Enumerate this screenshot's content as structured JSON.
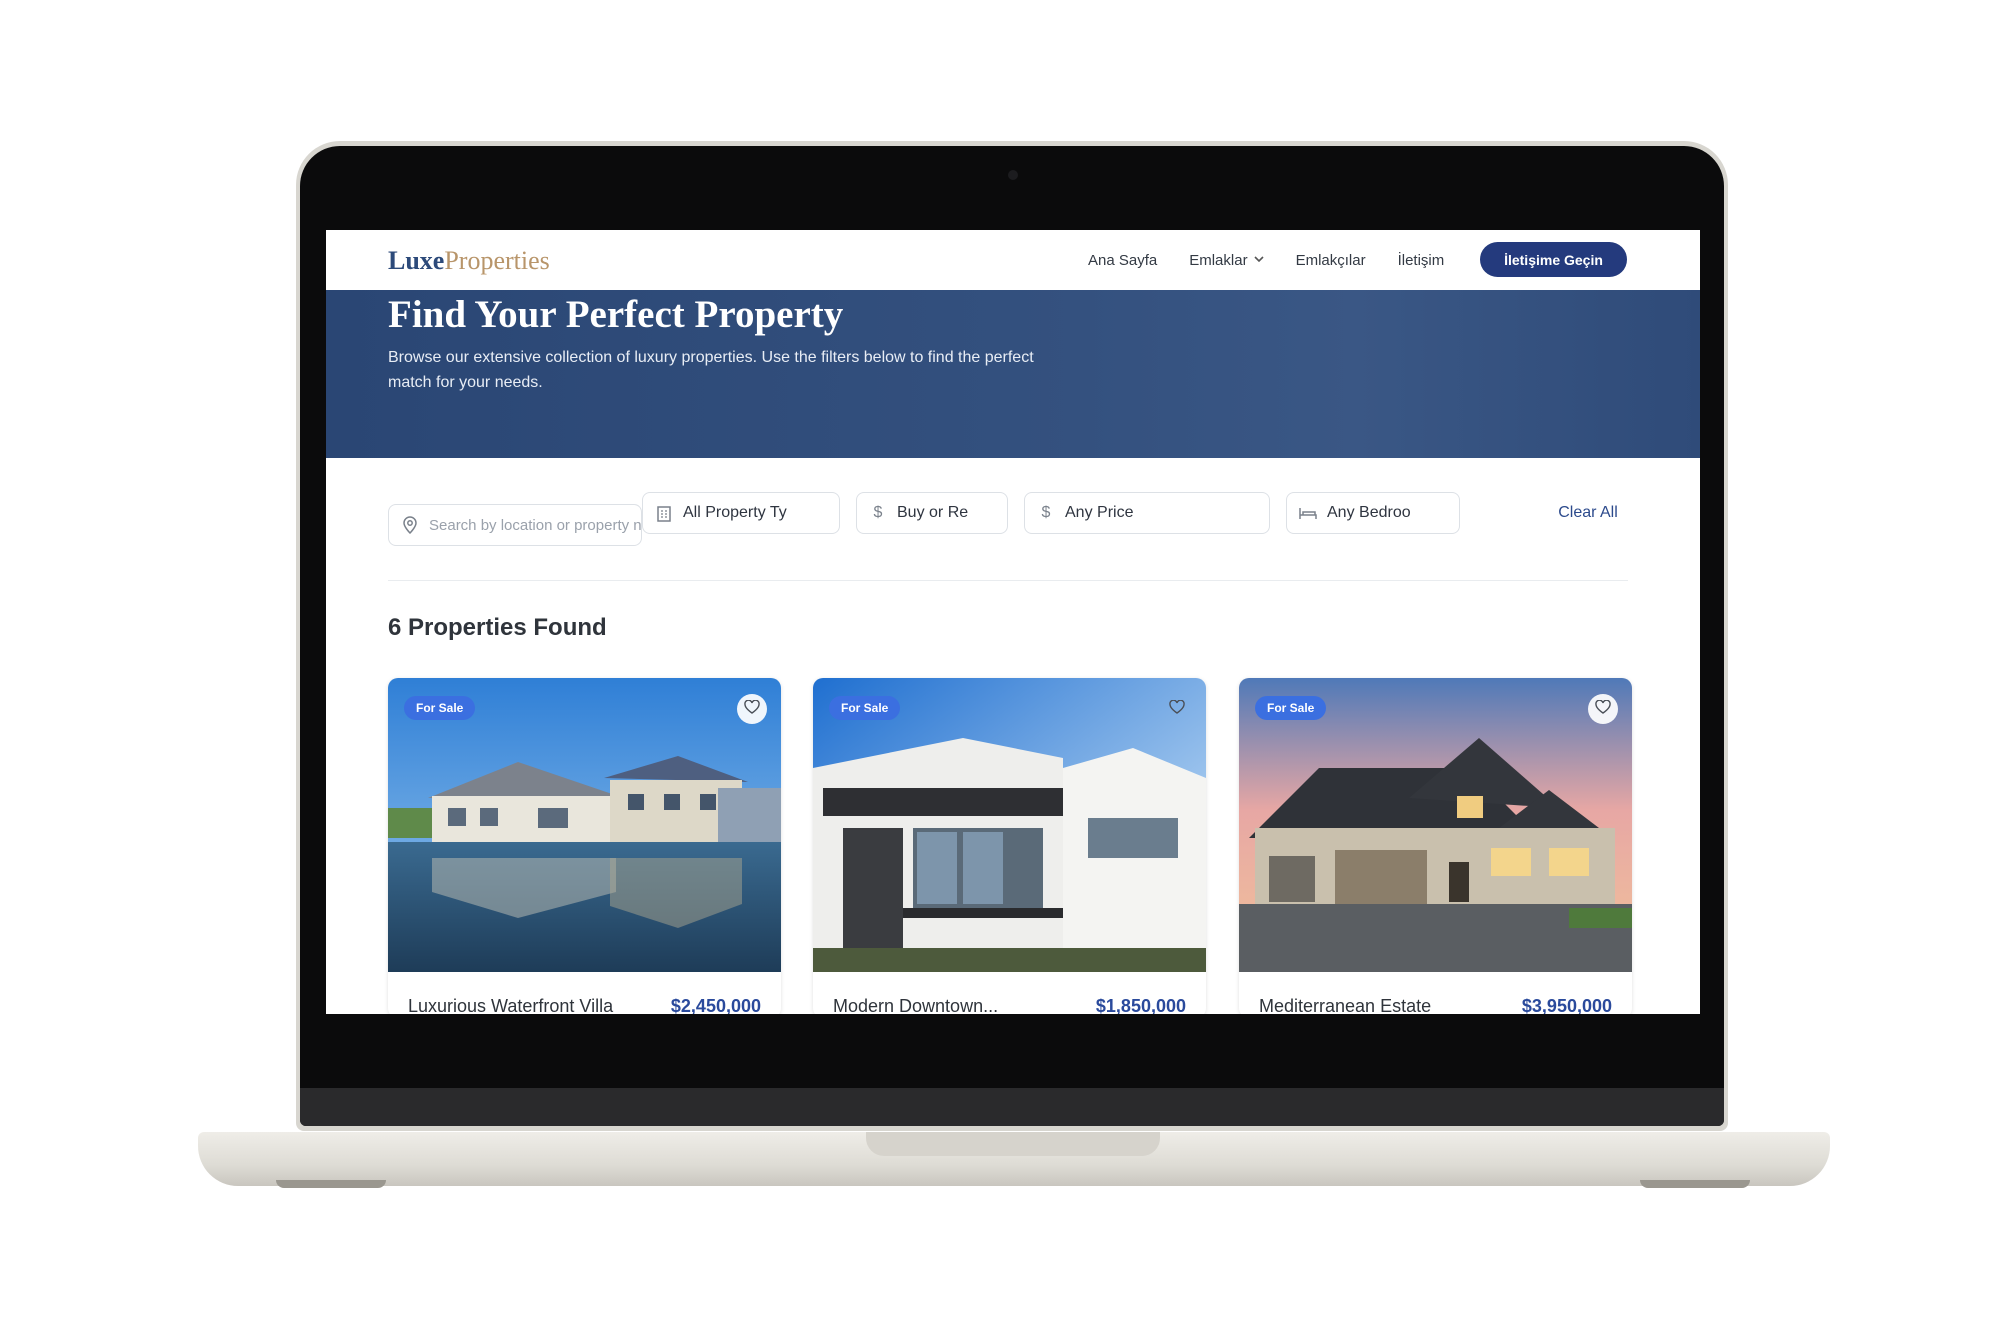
{
  "nav": {
    "logo_primary": "Luxe",
    "logo_secondary": "Properties",
    "links": [
      "Ana Sayfa",
      "Emlaklar",
      "Emlakçılar",
      "İletişim"
    ],
    "cta_label": "İletişime Geçin"
  },
  "hero": {
    "title": "Find Your Perfect Property",
    "subtitle": "Browse our extensive collection of luxury properties. Use the filters below to find the perfect match for your needs."
  },
  "filters": {
    "search_placeholder": "Search by location or property nam",
    "property_type": "All Property Ty",
    "listing_type": "Buy or Re",
    "price": "Any Price",
    "bedrooms": "Any Bedroo",
    "clear_label": "Clear All"
  },
  "results": {
    "count_title": "6 Properties Found"
  },
  "properties": [
    {
      "badge": "For Sale",
      "title": "Luxurious Waterfront Villa",
      "price": "$2,450,000"
    },
    {
      "badge": "For Sale",
      "title": "Modern Downtown...",
      "price": "$1,850,000"
    },
    {
      "badge": "For Sale",
      "title": "Mediterranean Estate",
      "price": "$3,950,000"
    }
  ],
  "colors": {
    "brand_navy": "#243a7d",
    "hero_bg": "#2f4b79",
    "badge_blue": "#3b6fe0",
    "price_blue": "#2a4a9c",
    "logo_gold": "#b8956a"
  }
}
